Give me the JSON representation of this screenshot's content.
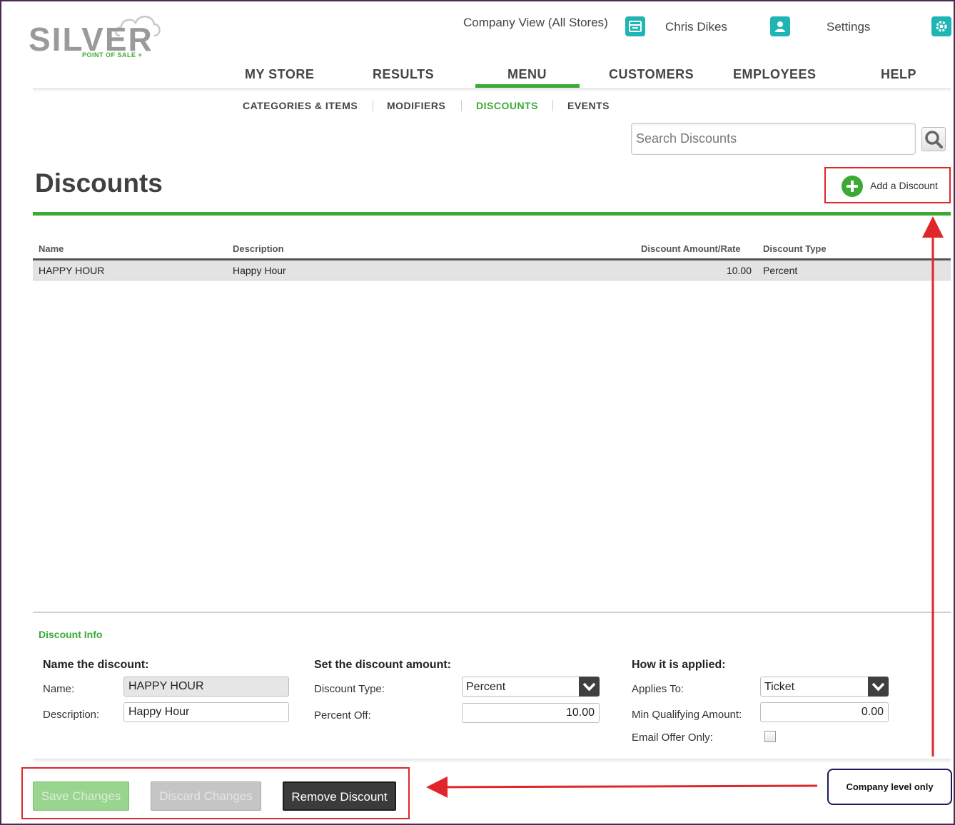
{
  "logo": {
    "word": "SILVER",
    "sub": "POINT OF SALE +"
  },
  "topbar": {
    "company_view": "Company View (All Stores)",
    "user": "Chris Dikes",
    "settings": "Settings",
    "icon_color": "#1fb5b5"
  },
  "mainnav": {
    "items": [
      "MY STORE",
      "RESULTS",
      "MENU",
      "CUSTOMERS",
      "EMPLOYEES",
      "HELP"
    ],
    "active": "MENU",
    "accent": "#3aaa35"
  },
  "subnav": {
    "items": [
      "CATEGORIES & ITEMS",
      "MODIFIERS",
      "DISCOUNTS",
      "EVENTS"
    ],
    "active": "DISCOUNTS"
  },
  "search": {
    "placeholder": "Search Discounts"
  },
  "page": {
    "title": "Discounts",
    "add_label": "Add a Discount"
  },
  "table": {
    "headers": [
      "Name",
      "Description",
      "Discount Amount/Rate",
      "Discount Type"
    ],
    "rows": [
      {
        "name": "HAPPY HOUR",
        "description": "Happy Hour",
        "amount": "10.00",
        "type": "Percent"
      }
    ]
  },
  "info": {
    "title": "Discount Info",
    "name_section": {
      "heading": "Name the discount:",
      "name_label": "Name:",
      "name_value": "HAPPY HOUR",
      "desc_label": "Description:",
      "desc_value": "Happy Hour"
    },
    "amount_section": {
      "heading": "Set the discount amount:",
      "type_label": "Discount Type:",
      "type_value": "Percent",
      "percent_label": "Percent Off:",
      "percent_value": "10.00"
    },
    "applied_section": {
      "heading": "How it is applied:",
      "applies_label": "Applies To:",
      "applies_value": "Ticket",
      "min_label": "Min Qualifying Amount:",
      "min_value": "0.00",
      "email_label": "Email Offer Only:",
      "email_checked": false
    }
  },
  "buttons": {
    "save": "Save Changes",
    "discard": "Discard Changes",
    "remove": "Remove Discount"
  },
  "annotation": {
    "callout": "Company level only",
    "color": "#e0262b"
  }
}
